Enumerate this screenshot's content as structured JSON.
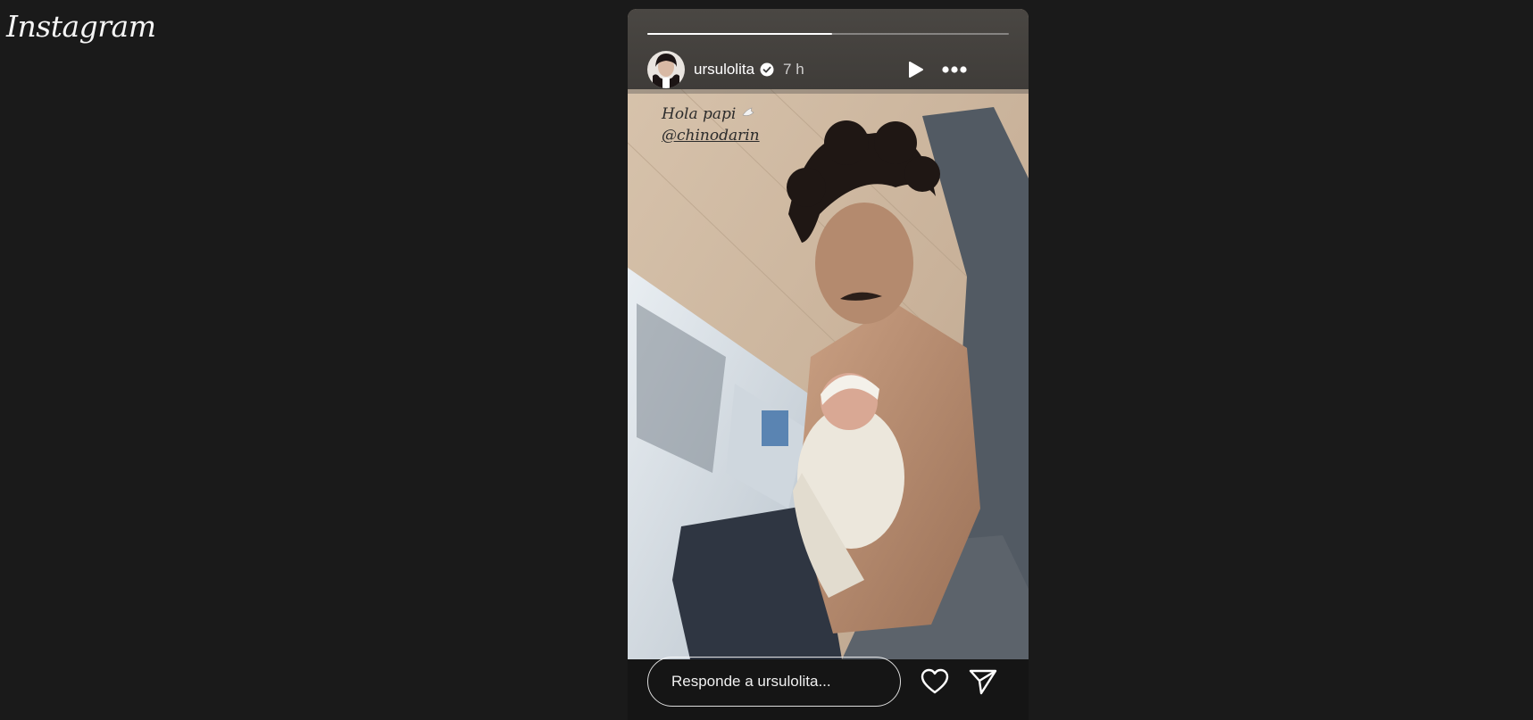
{
  "app": {
    "logo": "Instagram",
    "background": "#1a1a1a"
  },
  "story": {
    "progress": 0.51,
    "user": {
      "username": "ursulolita",
      "verified": true,
      "time": "7 h"
    },
    "caption": {
      "line1": "Hola papi",
      "mention": "@chinodarin"
    },
    "reply_placeholder": "Responde a ursulolita...",
    "icons": {
      "play": "play-icon",
      "more": "more-options-icon",
      "like": "heart-icon",
      "share": "send-icon",
      "verified": "verified-badge-icon",
      "dove": "dove-emoji"
    }
  }
}
